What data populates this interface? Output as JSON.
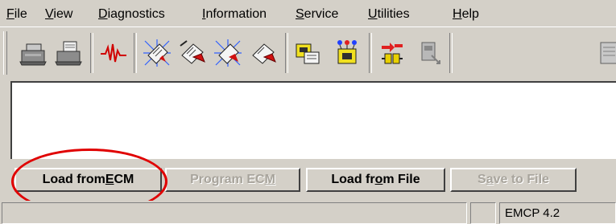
{
  "menubar": {
    "items": [
      {
        "label_pre": "",
        "accel": "F",
        "label_post": "ile"
      },
      {
        "label_pre": "",
        "accel": "V",
        "label_post": "iew"
      },
      {
        "label_pre": "",
        "accel": "D",
        "label_post": "iagnostics"
      },
      {
        "label_pre": "",
        "accel": "I",
        "label_post": "nformation"
      },
      {
        "label_pre": "",
        "accel": "S",
        "label_post": "ervice"
      },
      {
        "label_pre": "",
        "accel": "U",
        "label_post": "tilities"
      },
      {
        "label_pre": "",
        "accel": "H",
        "label_post": "elp"
      }
    ]
  },
  "toolbar": {
    "icons": [
      "printer-icon",
      "print-preview-icon",
      "ecg-waveform-icon",
      "ecm-flash-program-icon",
      "ecm-flash-edit-icon",
      "ecm-flash-verify-icon",
      "ecm-flash-write-icon",
      "ecm-download-icon",
      "ecm-connect-icon",
      "disconnect-icon",
      "ecm-info-icon",
      "document-icon"
    ]
  },
  "buttons": {
    "load_from_ecm": {
      "pre": "Load from ",
      "accel": "E",
      "post": "CM"
    },
    "program_ecm": {
      "pre": "Program EC",
      "accel": "M",
      "post": ""
    },
    "load_from_file": {
      "pre": "Load fr",
      "accel": "o",
      "post": "m File"
    },
    "save_to_file": {
      "pre": "S",
      "accel": "a",
      "post": "ve to File"
    }
  },
  "statusbar": {
    "pane1": "",
    "pane2": "",
    "pane3": "EMCP 4.2"
  },
  "colors": {
    "face": "#d4d0c8",
    "annotation": "#e00000",
    "disabled_text": "#a8a49c"
  }
}
